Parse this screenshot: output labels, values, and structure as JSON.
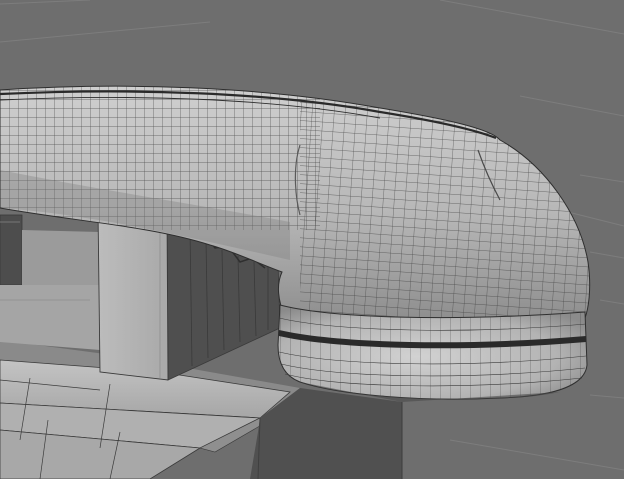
{
  "viewport": {
    "background_color": "#6e6e6e",
    "grid_color": "#7d7d7d",
    "surface_fill": "#b9b9b9",
    "surface_shade": "#9a9a9a",
    "dark_fill": "#4f4f4f",
    "wire_color": "#3a3a3a"
  },
  "scene": {
    "object_name": "",
    "display_mode": "wireframe-on-shaded"
  }
}
